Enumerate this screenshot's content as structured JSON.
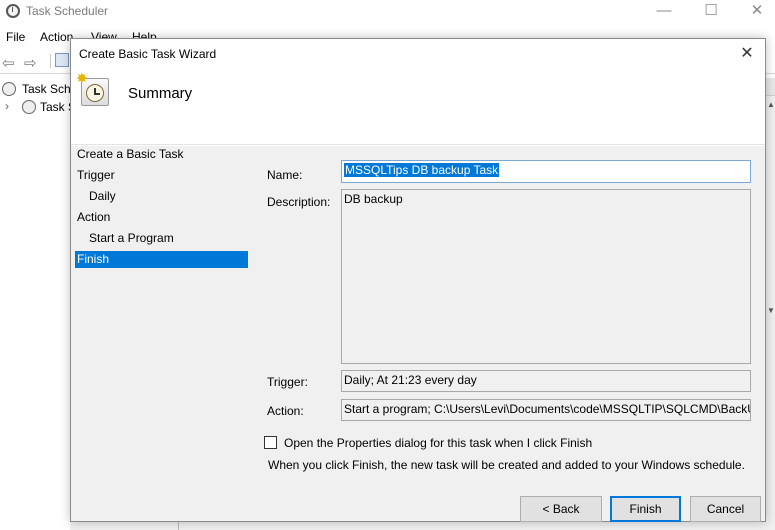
{
  "background_window": {
    "title": "Task Scheduler",
    "menu": [
      "File",
      "Action",
      "View",
      "Help"
    ],
    "controls": {
      "minimize": "—",
      "maximize": "☐",
      "close": "✕"
    },
    "tree": [
      {
        "label": "Task Scheduler (Local)"
      },
      {
        "label": "Task Scheduler Library"
      }
    ]
  },
  "dialog": {
    "title": "Create Basic Task Wizard",
    "close_glyph": "✕",
    "header": {
      "title": "Summary",
      "icon": "task-scheduler-wizard-icon"
    },
    "steps": [
      {
        "label": "Create a Basic Task",
        "sub": false,
        "active": false
      },
      {
        "label": "Trigger",
        "sub": false,
        "active": false
      },
      {
        "label": "Daily",
        "sub": true,
        "active": false
      },
      {
        "label": "Action",
        "sub": false,
        "active": false
      },
      {
        "label": "Start a Program",
        "sub": true,
        "active": false
      },
      {
        "label": "Finish",
        "sub": false,
        "active": true
      }
    ],
    "fields": {
      "name_label": "Name:",
      "name_value": "MSSQLTips DB backup Task",
      "description_label": "Description:",
      "description_value": "DB backup",
      "trigger_label": "Trigger:",
      "trigger_value": "Daily; At 21:23 every day",
      "action_label": "Action:",
      "action_value": "Start a program; C:\\Users\\Levi\\Documents\\code\\MSSQLTIP\\SQLCMD\\BackUp"
    },
    "open_properties": {
      "label": "Open the Properties dialog for this task when I click Finish",
      "checked": false
    },
    "info": "When you click Finish, the new task will be created and added to your Windows schedule.",
    "buttons": {
      "back": "< Back",
      "finish": "Finish",
      "cancel": "Cancel"
    },
    "colors": {
      "selection": "#0078d7",
      "body_bg": "#f0f0f0"
    }
  }
}
